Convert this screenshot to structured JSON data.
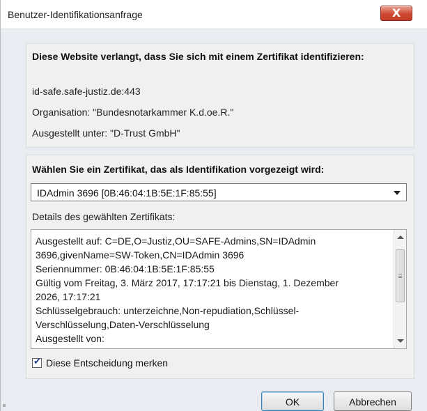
{
  "window": {
    "title": "Benutzer-Identifikationsanfrage",
    "close_glyph": "X"
  },
  "request": {
    "heading": "Diese Website verlangt, dass Sie sich mit einem Zertifikat identifizieren:",
    "host": "id-safe.safe-justiz.de:443",
    "organization": "Organisation: \"Bundesnotarkammer K.d.oe.R.\"",
    "issued_under": "Ausgestellt unter: \"D-Trust GmbH\""
  },
  "certificate": {
    "heading": "Wählen Sie ein Zertifikat, das als Identifikation vorgezeigt wird:",
    "selected": "IDAdmin 3696 [0B:46:04:1B:5E:1F:85:55]",
    "details_label": "Details des gewählten Zertifikats:",
    "details_lines": [
      "Ausgestellt auf: C=DE,O=Justiz,OU=SAFE-Admins,SN=IDAdmin",
      "3696,givenName=SW-Token,CN=IDAdmin 3696",
      "Seriennummer: 0B:46:04:1B:5E:1F:85:55",
      "Gültig vom Freitag, 3. März 2017, 17:17:21 bis Dienstag, 1. Dezember",
      "2026, 17:17:21",
      "Schlüsselgebrauch: unterzeichne,Non-repudiation,Schlüssel-",
      "Verschlüsselung,Daten-Verschlüsselung",
      "Ausgestellt von:"
    ],
    "remember_label": "Diese Entscheidung merken",
    "remember_checked": true,
    "check_glyph": "✔"
  },
  "buttons": {
    "ok": "OK",
    "cancel": "Abbrechen"
  }
}
